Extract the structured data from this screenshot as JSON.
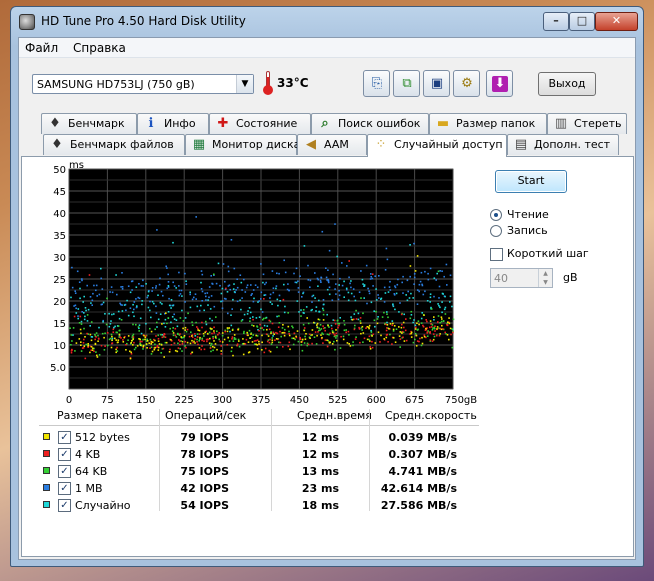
{
  "window": {
    "title": "HD Tune Pro 4.50 Hard Disk Utility",
    "min": "–",
    "max": "□",
    "close": "✕"
  },
  "menu": {
    "items": [
      "Файл",
      "Справка"
    ]
  },
  "toolbar": {
    "drive": "SAMSUNG HD753LJ (750 gB)",
    "temperature": "33°C",
    "exit_label": "Выход",
    "buttons": [
      {
        "icon": "copy-info-icon",
        "glyph": "⎘"
      },
      {
        "icon": "copy-screenshot-icon",
        "glyph": "⧉"
      },
      {
        "icon": "save-icon",
        "glyph": "▣"
      },
      {
        "icon": "options-icon",
        "glyph": "⚙"
      },
      {
        "icon": "download-arrow-icon",
        "glyph": "⬇"
      }
    ]
  },
  "tabs_top": [
    {
      "label": "Бенчмарк",
      "icon": "benchmark-icon",
      "glyph": "♦"
    },
    {
      "label": "Инфо",
      "icon": "info-icon",
      "glyph": "ℹ"
    },
    {
      "label": "Состояние",
      "icon": "health-cross-icon",
      "glyph": "✚"
    },
    {
      "label": "Поиск ошибок",
      "icon": "magnifier-icon",
      "glyph": "⌕"
    },
    {
      "label": "Размер папок",
      "icon": "folder-icon",
      "glyph": "▬"
    },
    {
      "label": "Стереть",
      "icon": "trash-icon",
      "glyph": "▥"
    }
  ],
  "tabs_bottom": [
    {
      "label": "Бенчмарк файлов",
      "icon": "file-benchmark-icon",
      "glyph": "♦"
    },
    {
      "label": "Монитор диска",
      "icon": "disk-monitor-icon",
      "glyph": "▦"
    },
    {
      "label": "AAM",
      "icon": "speaker-icon",
      "glyph": "◀"
    },
    {
      "label": "Случайный доступ",
      "icon": "random-access-icon",
      "glyph": "⁘"
    },
    {
      "label": "Дополн. тест",
      "icon": "extra-test-icon",
      "glyph": "▤"
    }
  ],
  "controls": {
    "start": "Start",
    "read": "Чтение",
    "write": "Запись",
    "short_stroke": "Короткий шаг",
    "short_stroke_value": "40",
    "short_stroke_unit": "gB",
    "mode": "read"
  },
  "chart_data": {
    "type": "scatter",
    "xlabel": "",
    "ylabel": "ms",
    "xlim": [
      0,
      750
    ],
    "ylim": [
      0,
      50
    ],
    "x_ticks": [
      "0",
      "75",
      "150",
      "225",
      "300",
      "375",
      "450",
      "525",
      "600",
      "675",
      "750gB"
    ],
    "y_ticks": [
      "50",
      "45",
      "40",
      "35",
      "30",
      "25",
      "20",
      "15",
      "10",
      "5.0"
    ],
    "grid": true,
    "background": "#000000",
    "series": [
      {
        "name": "512 bytes",
        "color": "#f2e600",
        "mean_ms": 12,
        "range_ms": [
          7,
          17
        ]
      },
      {
        "name": "4 KB",
        "color": "#ee2020",
        "mean_ms": 12,
        "range_ms": [
          7,
          17
        ]
      },
      {
        "name": "64 KB",
        "color": "#35d035",
        "mean_ms": 13,
        "range_ms": [
          7,
          19
        ]
      },
      {
        "name": "1 MB",
        "color": "#2a7de0",
        "mean_ms": 23,
        "range_ms": [
          14,
          28
        ]
      },
      {
        "name": "Случайно",
        "color": "#20d8d8",
        "mean_ms": 18,
        "range_ms": [
          8,
          27
        ]
      }
    ]
  },
  "table": {
    "headers": [
      "Размер пакета",
      "Операций/сек",
      "Средн.время",
      "Средн.скорость"
    ],
    "rows": [
      {
        "name": "512 bytes",
        "color": "#f2e600",
        "iops": "79 IOPS",
        "time": "12 ms",
        "speed": "0.039 MB/s"
      },
      {
        "name": "4 KB",
        "color": "#ee2020",
        "iops": "78 IOPS",
        "time": "12 ms",
        "speed": "0.307 MB/s"
      },
      {
        "name": "64 KB",
        "color": "#35d035",
        "iops": "75 IOPS",
        "time": "13 ms",
        "speed": "4.741 MB/s"
      },
      {
        "name": "1 MB",
        "color": "#2a7de0",
        "iops": "42 IOPS",
        "time": "23 ms",
        "speed": "42.614 MB/s"
      },
      {
        "name": "Случайно",
        "color": "#20d8d8",
        "iops": "54 IOPS",
        "time": "18 ms",
        "speed": "27.586 MB/s"
      }
    ]
  }
}
